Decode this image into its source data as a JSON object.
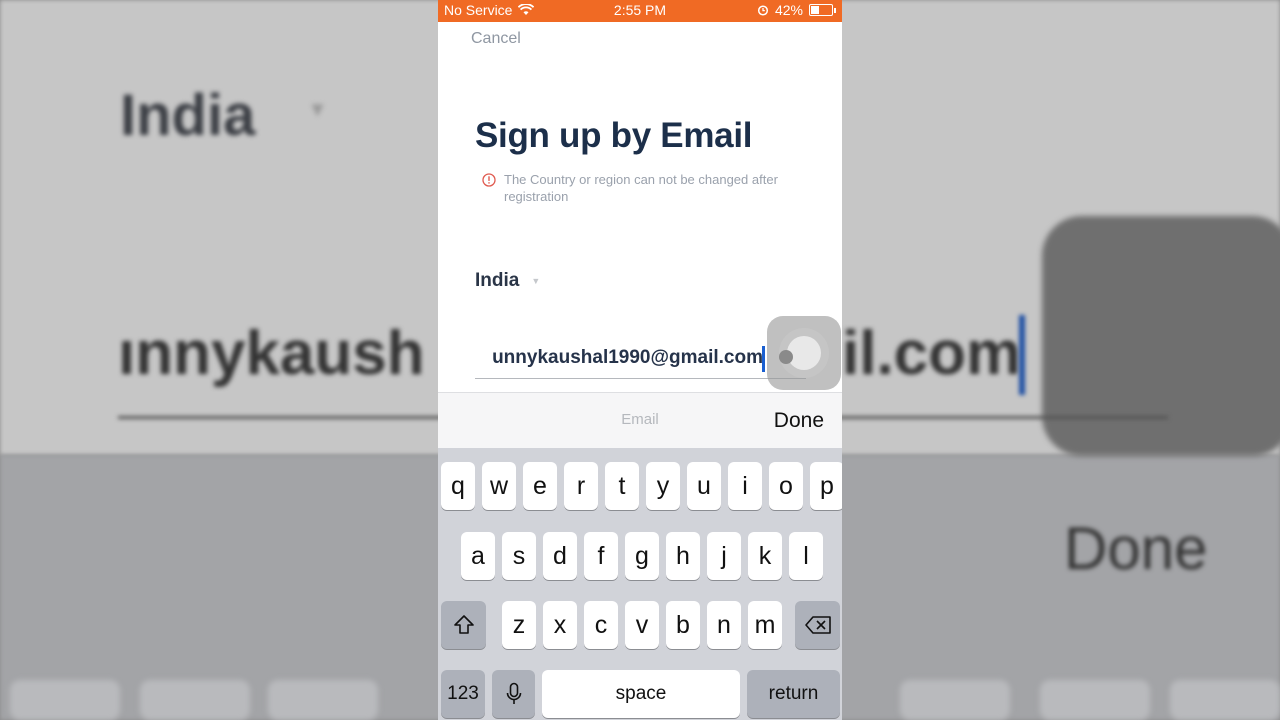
{
  "backdrop": {
    "country": "India",
    "email_left": "ınnykaush",
    "email_right": "il.com",
    "done": "Done"
  },
  "statusbar": {
    "carrier": "No Service",
    "time": "2:55 PM",
    "battery": "42%"
  },
  "nav": {
    "cancel_label": "Cancel"
  },
  "page": {
    "title": "Sign up by Email",
    "notice": "The Country or region can not be changed after registration"
  },
  "form": {
    "country": "India",
    "email_value": "unnykaushal1990@gmail.com"
  },
  "keyboard": {
    "hint": "Email",
    "done_label": "Done",
    "rows": [
      [
        "q",
        "w",
        "e",
        "r",
        "t",
        "y",
        "u",
        "i",
        "o",
        "p"
      ],
      [
        "a",
        "s",
        "d",
        "f",
        "g",
        "h",
        "j",
        "k",
        "l"
      ],
      [
        "z",
        "x",
        "c",
        "v",
        "b",
        "n",
        "m"
      ]
    ],
    "numbers_label": "123",
    "space_label": "space",
    "return_label": "return"
  },
  "colors": {
    "status_bar": "#f06a24",
    "title": "#1c2f4a",
    "cursor": "#1a5fd1",
    "notice_icon": "#e05a4f"
  }
}
